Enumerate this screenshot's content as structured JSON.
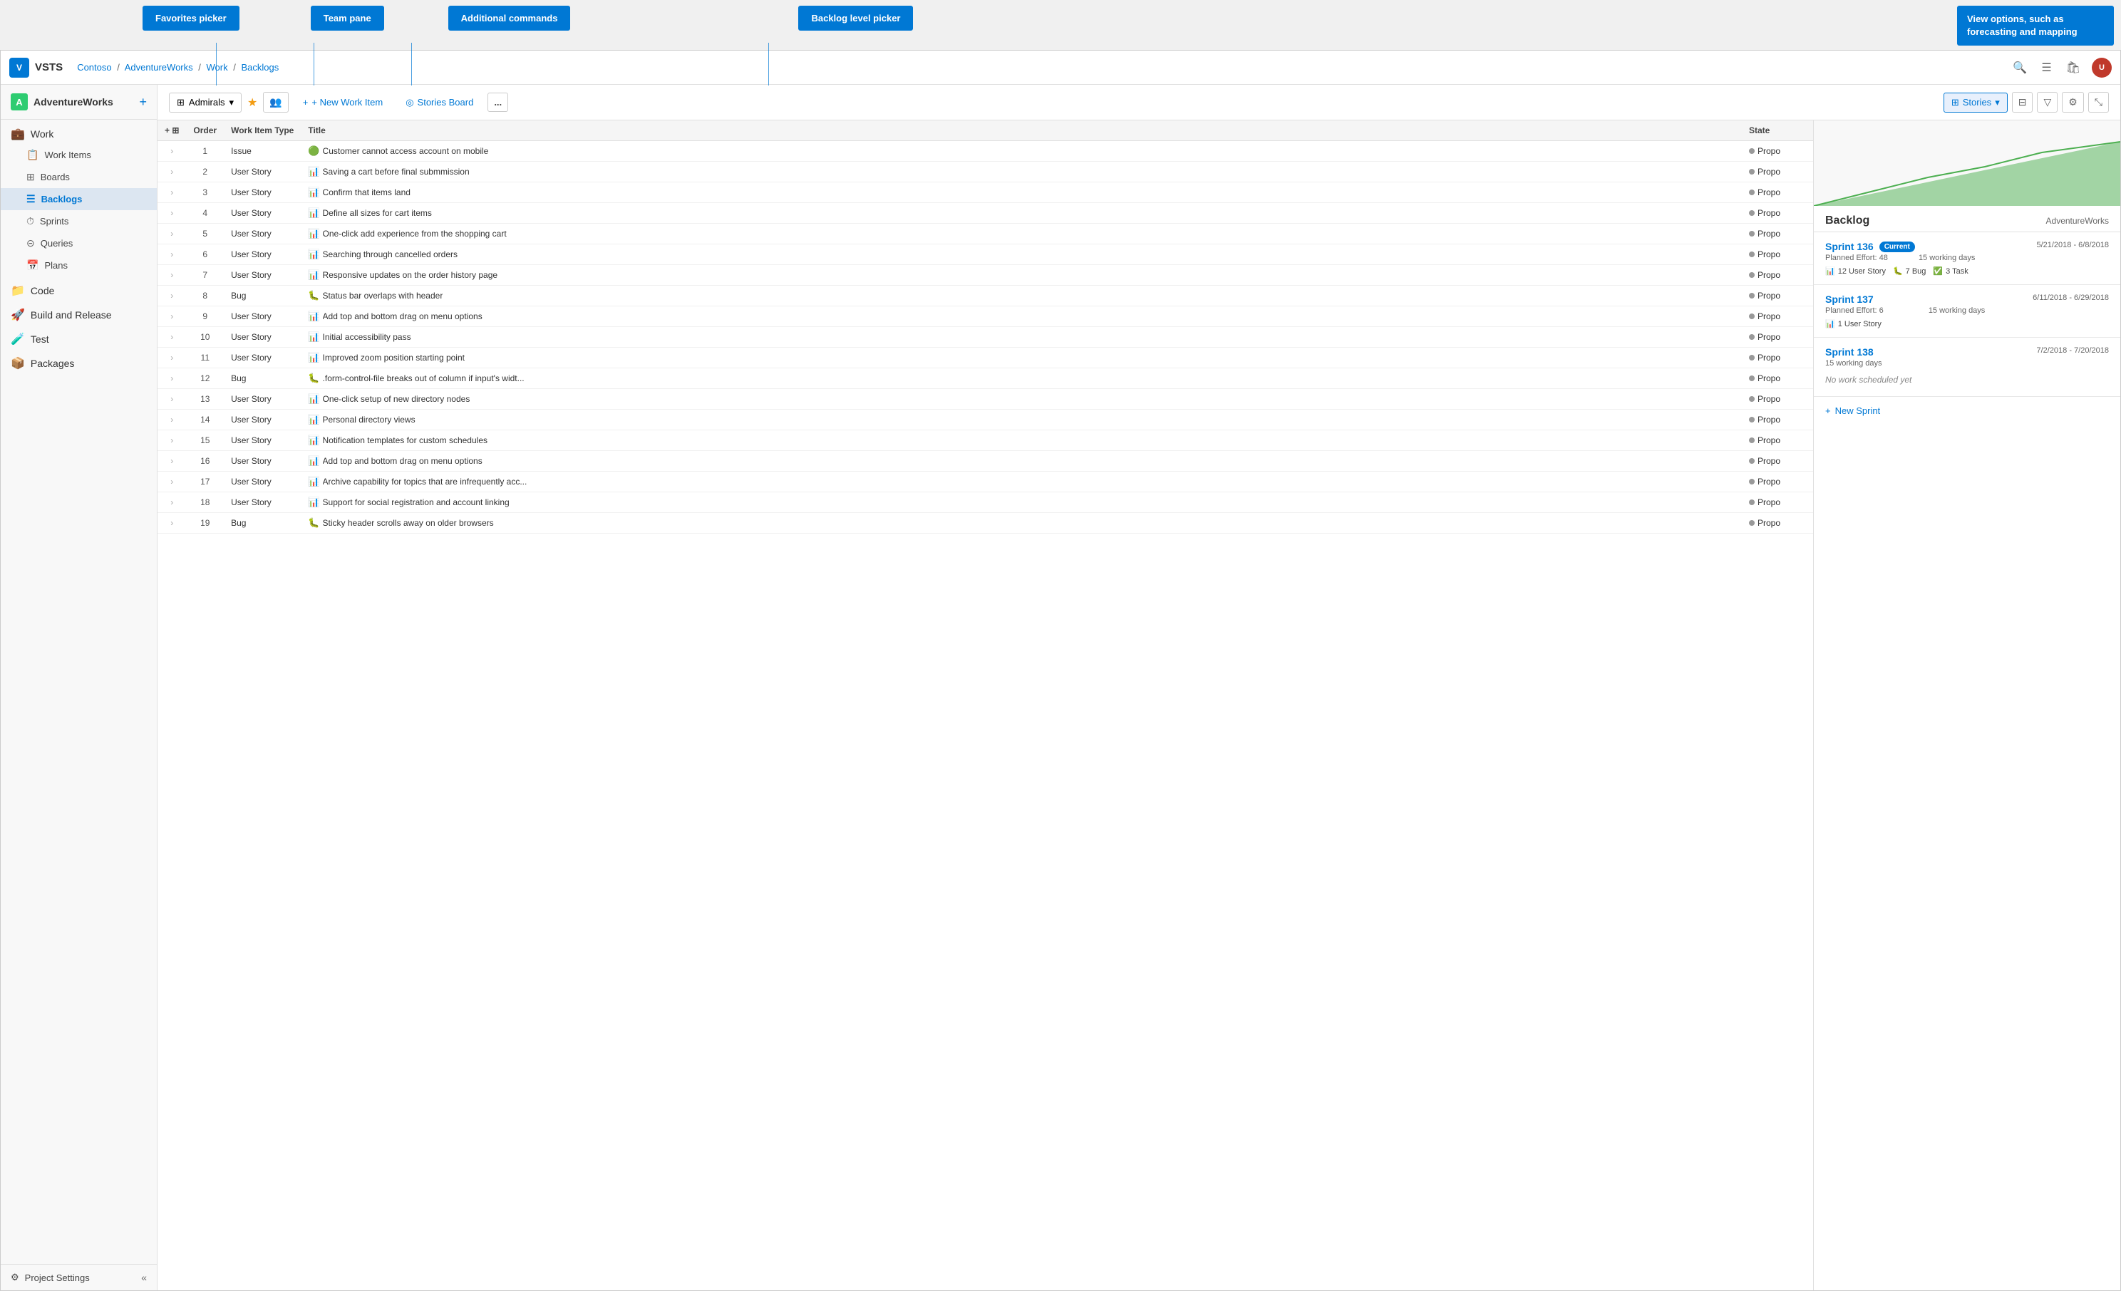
{
  "app": {
    "logo_text": "VSTS",
    "project_name": "AdventureWorks",
    "project_initial": "A"
  },
  "breadcrumb": {
    "items": [
      "Contoso",
      "AdventureWorks",
      "Work",
      "Backlogs"
    ]
  },
  "tooltip_bar": {
    "favorites_label": "Favorites picker",
    "team_label": "Team pane",
    "additional_label": "Additional commands",
    "backlog_label": "Backlog level picker",
    "view_options_text": "View options, such as forecasting and mapping"
  },
  "toolbar": {
    "team_name": "Admirals",
    "new_work_item_label": "+ New Work Item",
    "stories_board_label": "Stories Board",
    "more_label": "...",
    "stories_dropdown_label": "Stories",
    "filter_icon": "⚙",
    "settings_icon": "⚙",
    "expand_icon": "⤡"
  },
  "sidebar": {
    "sections": [
      {
        "label": "Work",
        "icon": "💼",
        "items": [
          {
            "label": "Work Items",
            "icon": "📋",
            "active": false
          },
          {
            "label": "Boards",
            "icon": "⊞",
            "active": false
          },
          {
            "label": "Backlogs",
            "icon": "☰",
            "active": true
          },
          {
            "label": "Sprints",
            "icon": "⏱",
            "active": false
          },
          {
            "label": "Queries",
            "icon": "⊝",
            "active": false
          },
          {
            "label": "Plans",
            "icon": "📅",
            "active": false
          }
        ]
      },
      {
        "label": "Code",
        "icon": "📁",
        "items": []
      },
      {
        "label": "Build and Release",
        "icon": "🚀",
        "items": []
      },
      {
        "label": "Test",
        "icon": "🧪",
        "items": []
      },
      {
        "label": "Packages",
        "icon": "📦",
        "items": []
      }
    ],
    "project_settings": "Project Settings"
  },
  "table": {
    "columns": [
      "",
      "Order",
      "Work Item Type",
      "Title",
      "State"
    ],
    "rows": [
      {
        "order": 1,
        "type": "Issue",
        "type_class": "issue",
        "title": "Customer cannot access account on mobile",
        "title_icon": "🔴",
        "state": "Propo"
      },
      {
        "order": 2,
        "type": "User Story",
        "type_class": "story",
        "title": "Saving a cart before final submmission",
        "title_icon": "📊",
        "state": "Propo"
      },
      {
        "order": 3,
        "type": "User Story",
        "type_class": "story",
        "title": "Confirm that items land",
        "title_icon": "📊",
        "state": "Propo"
      },
      {
        "order": 4,
        "type": "User Story",
        "type_class": "story",
        "title": "Define all sizes for cart items",
        "title_icon": "📊",
        "state": "Propo"
      },
      {
        "order": 5,
        "type": "User Story",
        "type_class": "story",
        "title": "One-click add experience from the shopping cart",
        "title_icon": "📊",
        "state": "Propo"
      },
      {
        "order": 6,
        "type": "User Story",
        "type_class": "story",
        "title": "Searching through cancelled orders",
        "title_icon": "📊",
        "state": "Propo"
      },
      {
        "order": 7,
        "type": "User Story",
        "type_class": "story",
        "title": "Responsive updates on the order history page",
        "title_icon": "📊",
        "state": "Propo"
      },
      {
        "order": 8,
        "type": "Bug",
        "type_class": "bug",
        "title": "Status bar overlaps with header",
        "title_icon": "🐛",
        "state": "Propo"
      },
      {
        "order": 9,
        "type": "User Story",
        "type_class": "story",
        "title": "Add top and bottom drag on menu options",
        "title_icon": "📊",
        "state": "Propo"
      },
      {
        "order": 10,
        "type": "User Story",
        "type_class": "story",
        "title": "Initial accessibility pass",
        "title_icon": "📊",
        "state": "Propo"
      },
      {
        "order": 11,
        "type": "User Story",
        "type_class": "story",
        "title": "Improved zoom position starting point",
        "title_icon": "📊",
        "state": "Propo"
      },
      {
        "order": 12,
        "type": "Bug",
        "type_class": "bug",
        "title": ".form-control-file breaks out of column if input's widt...",
        "title_icon": "🐛",
        "state": "Propo"
      },
      {
        "order": 13,
        "type": "User Story",
        "type_class": "story",
        "title": "One-click setup of new directory nodes",
        "title_icon": "📊",
        "state": "Propo"
      },
      {
        "order": 14,
        "type": "User Story",
        "type_class": "story",
        "title": "Personal directory views",
        "title_icon": "📊",
        "state": "Propo"
      },
      {
        "order": 15,
        "type": "User Story",
        "type_class": "story",
        "title": "Notification templates for custom schedules",
        "title_icon": "📊",
        "state": "Propo"
      },
      {
        "order": 16,
        "type": "User Story",
        "type_class": "story",
        "title": "Add top and bottom drag on menu options",
        "title_icon": "📊",
        "state": "Propo"
      },
      {
        "order": 17,
        "type": "User Story",
        "type_class": "story",
        "title": "Archive capability for topics that are infrequently acc...",
        "title_icon": "📊",
        "state": "Propo"
      },
      {
        "order": 18,
        "type": "User Story",
        "type_class": "story",
        "title": "Support for social registration and account linking",
        "title_icon": "📊",
        "state": "Propo"
      },
      {
        "order": 19,
        "type": "Bug",
        "type_class": "bug",
        "title": "Sticky header scrolls away on older browsers",
        "title_icon": "🐛",
        "state": "Propo"
      }
    ]
  },
  "backlog_panel": {
    "title": "Backlog",
    "org": "AdventureWorks",
    "sprints": [
      {
        "name": "Sprint 136",
        "current": true,
        "current_label": "Current",
        "date": "5/21/2018 - 6/8/2018",
        "planned_effort_label": "Planned Effort: 48",
        "working_days": "15 working days",
        "badges": [
          {
            "icon": "📊",
            "count": "12",
            "label": "User Story",
            "type": "story"
          },
          {
            "icon": "🐛",
            "count": "7",
            "label": "Bug",
            "type": "bug"
          },
          {
            "icon": "✅",
            "count": "3",
            "label": "Task",
            "type": "task"
          }
        ]
      },
      {
        "name": "Sprint 137",
        "current": false,
        "date": "6/11/2018 - 6/29/2018",
        "planned_effort_label": "Planned Effort: 6",
        "working_days": "15 working days",
        "badges": [
          {
            "icon": "📊",
            "count": "1",
            "label": "User Story",
            "type": "story"
          }
        ]
      },
      {
        "name": "Sprint 138",
        "current": false,
        "date": "7/2/2018 - 7/20/2018",
        "planned_effort_label": "",
        "working_days": "15 working days",
        "no_work": "No work scheduled yet",
        "badges": []
      }
    ],
    "new_sprint_label": "+ New Sprint"
  }
}
